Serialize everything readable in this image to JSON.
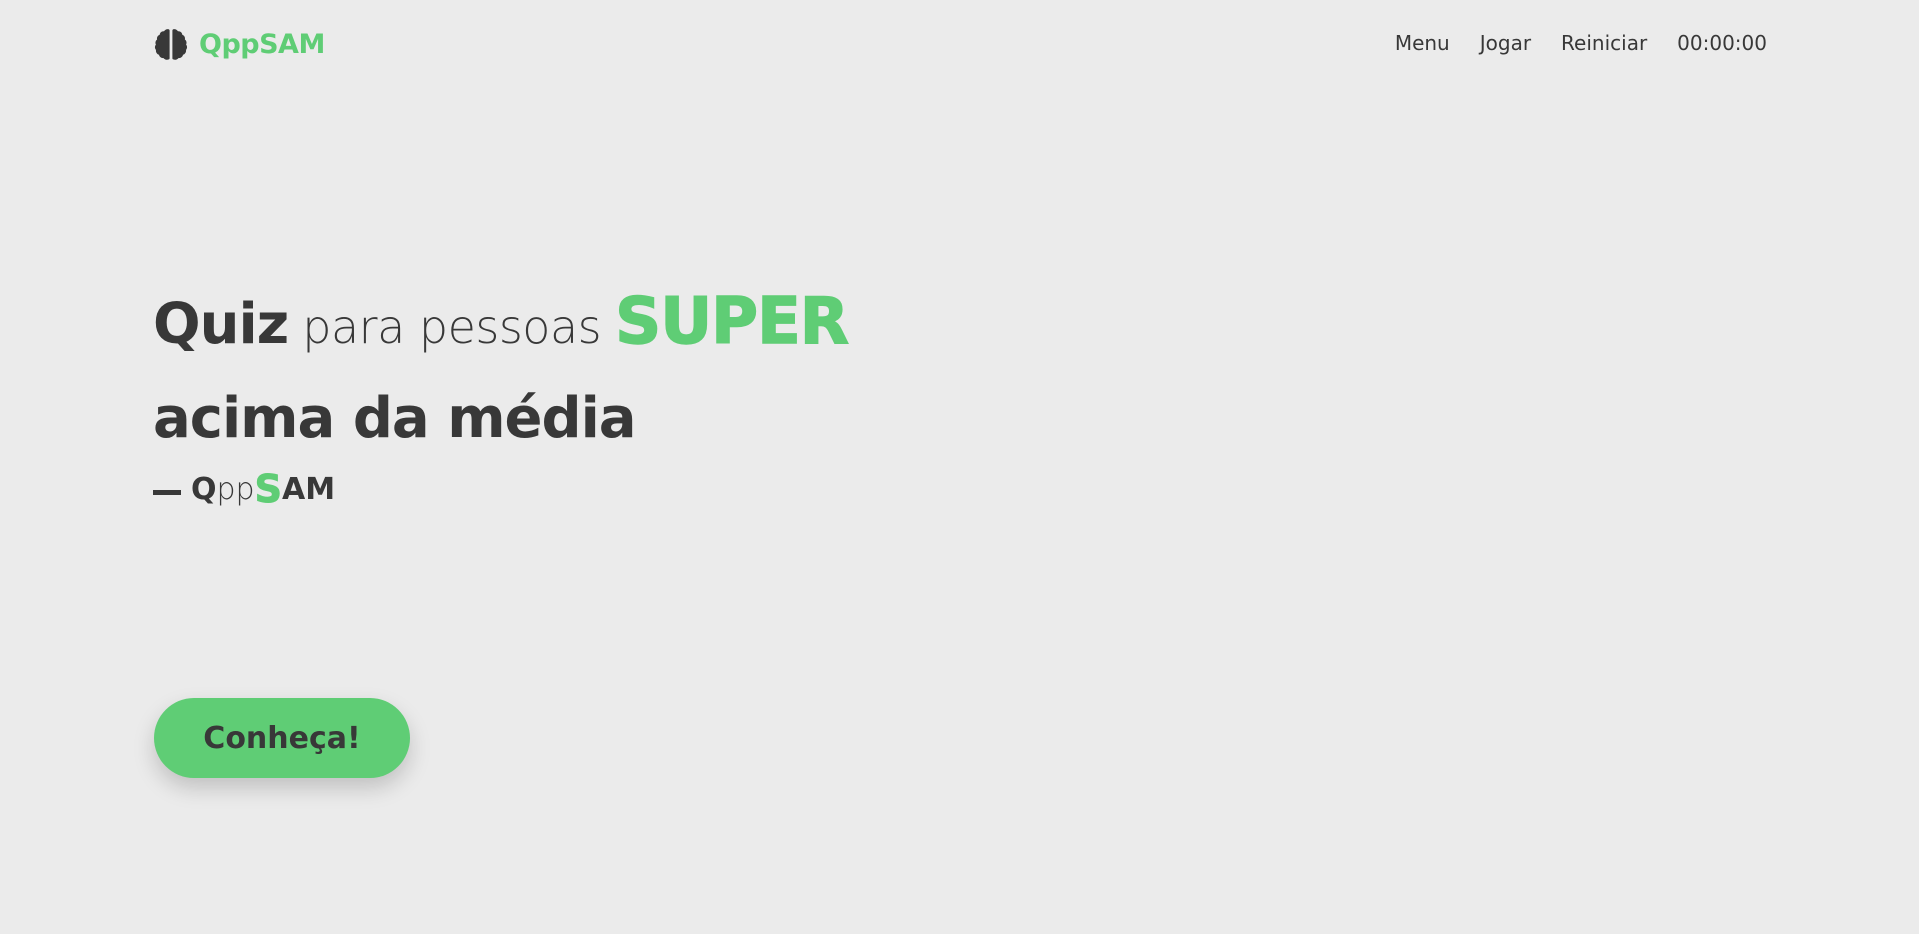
{
  "colors": {
    "accent": "#5fcd75",
    "text": "#383838",
    "background": "#ebebeb"
  },
  "header": {
    "logo_icon": "brain-icon",
    "logo_text": "QppSAM",
    "nav": {
      "menu": "Menu",
      "play": "Jogar",
      "restart": "Reiniciar",
      "timer": "00:00:00"
    }
  },
  "hero": {
    "word_quiz": "Quiz",
    "word_para_pessoas": "para pessoas",
    "word_super": "SUPER",
    "line2": "acima da média",
    "signature": {
      "q": "Q",
      "pp": "pp",
      "s": "S",
      "am": "AM"
    }
  },
  "cta": {
    "label": "Conheça!"
  }
}
